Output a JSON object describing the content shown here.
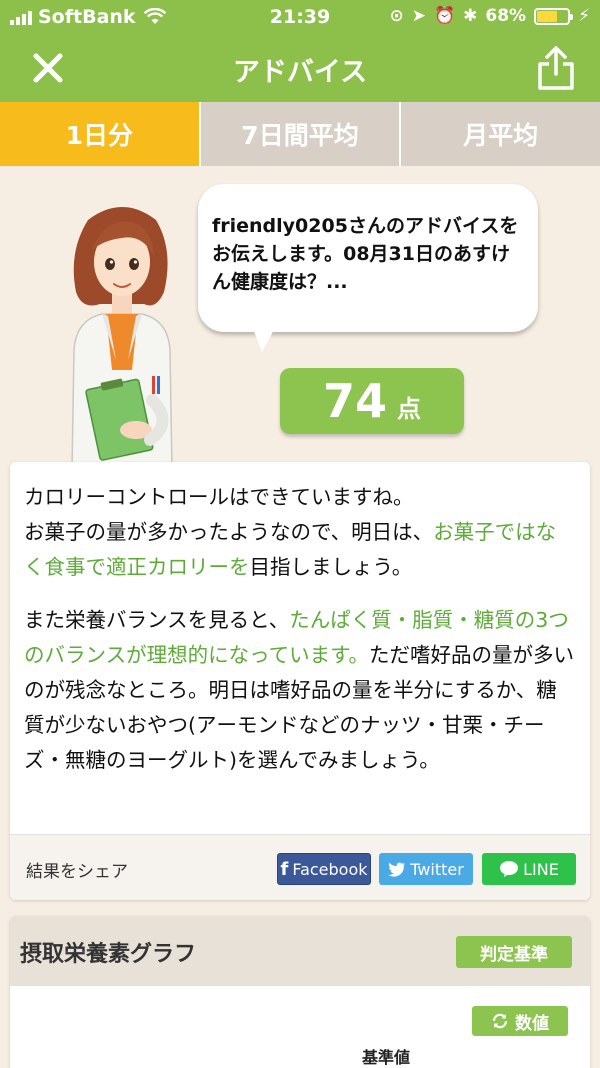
{
  "status_bar": {
    "carrier": "SoftBank",
    "time": "21:39",
    "battery": "68%",
    "battery_level": 0.68,
    "icons": [
      "signal-icon",
      "wifi-icon",
      "screen-lock-icon",
      "location-icon",
      "alarm-icon",
      "bluetooth-icon",
      "battery-icon",
      "charging-icon"
    ]
  },
  "nav": {
    "title": "アドバイス",
    "close_icon": "close-icon",
    "share_icon": "share-icon"
  },
  "tabs": [
    {
      "label": "1日分",
      "active": true
    },
    {
      "label": "7日間平均",
      "active": false
    },
    {
      "label": "月平均",
      "active": false
    }
  ],
  "advice": {
    "bubble_text": "friendly0205さんのアドバイスをお伝えします。08月31日のあすけん健康度は？...",
    "score": "74",
    "score_unit": "点"
  },
  "comment": {
    "p1_line1": "カロリーコントロールはできていますね。",
    "p1_a": "お菓子の量が多かったようなので、明日は、",
    "p1_hl": "お菓子ではなく食事で適正カロリーを",
    "p1_b": "目指しましょう。",
    "p2_a": "また栄養バランスを見ると、",
    "p2_hl": "たんぱく質・脂質・糖質の3つのバランスが理想的になっています。",
    "p2_b": "ただ嗜好品の量が多いのが残念なところ。明日は嗜好品の量を半分にするか、糖質が少ないおやつ(アーモンドなどのナッツ・甘栗・チーズ・無糖のヨーグルト)を選んでみましょう。"
  },
  "share": {
    "label": "結果をシェア",
    "facebook": "Facebook",
    "twitter": "Twitter",
    "line": "LINE"
  },
  "graph": {
    "title": "摂取栄養素グラフ",
    "criteria_button": "判定基準",
    "values_button": "数値",
    "baseline_label": "基準値"
  },
  "colors": {
    "brand_green": "#8cc04a",
    "active_tab": "#f8bb1c",
    "inactive_tab": "#d8d0c6",
    "highlight_text": "#5eab3a",
    "facebook": "#3b5998",
    "twitter": "#4aaae6",
    "line": "#2fc24a"
  }
}
